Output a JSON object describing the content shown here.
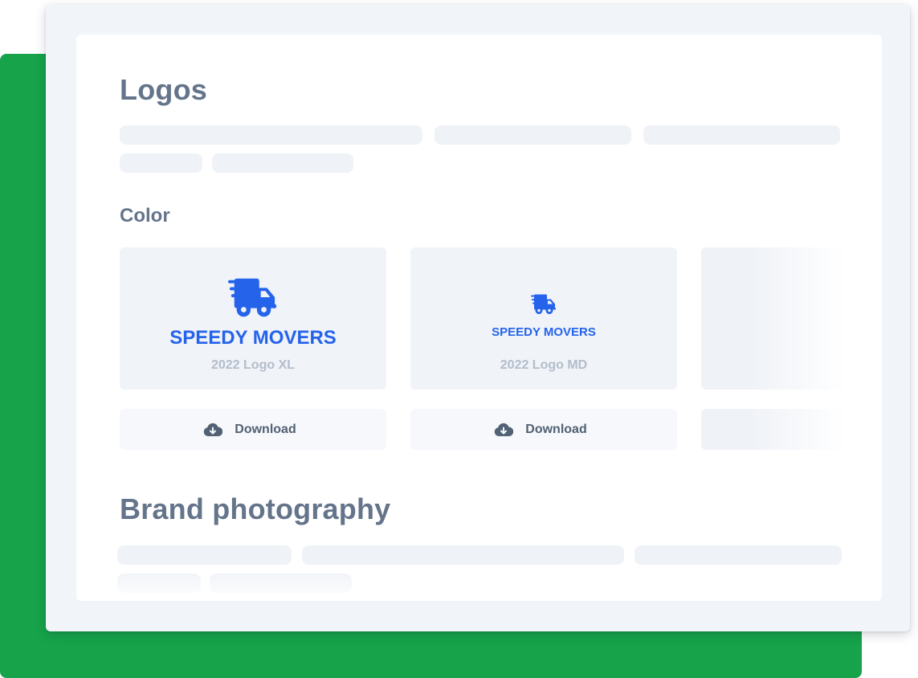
{
  "page": {
    "section_title": "Logos",
    "subsection_title": "Color",
    "section2_title": "Brand photography"
  },
  "logos": [
    {
      "brand": "SPEEDY MOVERS",
      "caption": "2022 Logo XL",
      "icon": "truck-icon",
      "download_label": "Download",
      "download_icon": "cloud-download-icon"
    },
    {
      "brand": "SPEEDY MOVERS",
      "caption": "2022 Logo MD",
      "icon": "truck-icon",
      "download_label": "Download",
      "download_icon": "cloud-download-icon"
    }
  ],
  "colors": {
    "background_accent": "#16a34a",
    "brand_blue": "#2563eb",
    "heading_gray": "#64748b",
    "caption_gray": "#b3bdca",
    "placeholder": "#eff2f7"
  }
}
